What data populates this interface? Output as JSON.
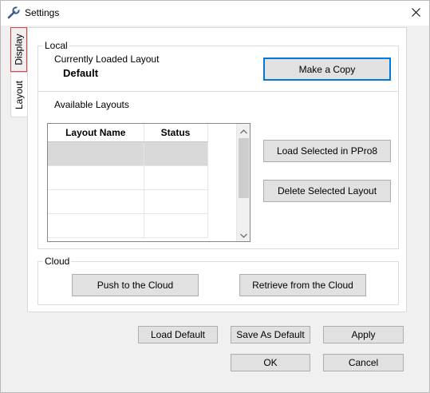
{
  "window": {
    "title": "Settings"
  },
  "tabs": [
    {
      "label": "Display",
      "selected": false
    },
    {
      "label": "Layout",
      "selected": true
    }
  ],
  "local": {
    "label": "Local",
    "current_label": "Currently Loaded Layout",
    "current_value": "Default",
    "copy_button": "Make a Copy",
    "available_label": "Available Layouts",
    "columns": [
      "Layout Name",
      "Status"
    ],
    "rows": [
      {
        "name": "",
        "status": "",
        "selected": true
      },
      {
        "name": "",
        "status": "",
        "selected": false
      },
      {
        "name": "",
        "status": "",
        "selected": false
      },
      {
        "name": "",
        "status": "",
        "selected": false
      }
    ],
    "load_button": "Load Selected in PPro8",
    "delete_button": "Delete Selected Layout"
  },
  "cloud": {
    "label": "Cloud",
    "push_button": "Push to the Cloud",
    "retrieve_button": "Retrieve from the Cloud"
  },
  "footer": {
    "load_default": "Load Default",
    "save_as_default": "Save As Default",
    "apply": "Apply",
    "ok": "OK",
    "cancel": "Cancel"
  },
  "icons": {
    "app": "wrench-icon",
    "close": "close-icon",
    "scroll_up": "chevron-up-icon",
    "scroll_down": "chevron-down-icon"
  },
  "colors": {
    "focus_border": "#0078d7",
    "active_tab_border": "#e04040",
    "selected_row": "#d9d9d9"
  }
}
